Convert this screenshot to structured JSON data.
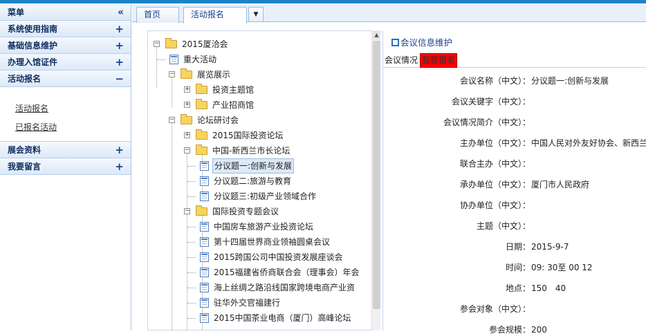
{
  "menu": {
    "header": {
      "label": "菜单",
      "icon": "double-chevron-left-icon"
    },
    "sections": [
      {
        "label": "系统使用指南",
        "sign": "+"
      },
      {
        "label": "基础信息维护",
        "sign": "+"
      },
      {
        "label": "办理入馆证件",
        "sign": "+"
      },
      {
        "label": "活动报名",
        "sign": "−"
      }
    ],
    "subitems": [
      "活动报名",
      "已报名活动"
    ],
    "bottom_sections": [
      {
        "label": "展会资料",
        "sign": "+"
      },
      {
        "label": "我要留言",
        "sign": "+"
      }
    ]
  },
  "tabs": [
    {
      "label": "首页"
    },
    {
      "label": "活动报名"
    }
  ],
  "tab_dropdown_icon": "▼",
  "tree": {
    "nodes": [
      {
        "label": "2015厦洽会",
        "type": "folder",
        "toggle": "−"
      },
      {
        "label": "重大活动",
        "type": "doc"
      },
      {
        "label": "展览展示",
        "type": "folder",
        "toggle": "−"
      },
      {
        "label": "投资主题馆",
        "type": "folder",
        "toggle": "+"
      },
      {
        "label": "产业招商馆",
        "type": "folder",
        "toggle": "+"
      },
      {
        "label": "论坛研讨会",
        "type": "folder",
        "toggle": "−"
      },
      {
        "label": "2015国际投资论坛",
        "type": "folder",
        "toggle": "+"
      },
      {
        "label": "中国-新西兰市长论坛",
        "type": "folder",
        "toggle": "−"
      },
      {
        "label": "分议题一:创新与发展",
        "type": "doc",
        "selected": true
      },
      {
        "label": "分议题二:旅游与教育",
        "type": "doc"
      },
      {
        "label": "分议题三:初级产业领域合作",
        "type": "doc"
      },
      {
        "label": "国际投资专题会议",
        "type": "folder",
        "toggle": "−"
      },
      {
        "label": "中国房车旅游产业投资论坛",
        "type": "doc"
      },
      {
        "label": "第十四届世界商业领袖圆桌会议",
        "type": "doc"
      },
      {
        "label": "2015跨国公司中国投资发展座谈会",
        "type": "doc"
      },
      {
        "label": "2015福建省侨商联合会（理事会）年会",
        "type": "doc"
      },
      {
        "label": "海上丝绸之路沿线国家跨境电商产业资",
        "type": "doc"
      },
      {
        "label": "驻华外交官福建行",
        "type": "doc"
      },
      {
        "label": "2015中国茶业电商（厦门）高峰论坛",
        "type": "doc"
      }
    ]
  },
  "panel": {
    "title": "会议信息维护",
    "subtabs": [
      "会议情况",
      "我要报名"
    ],
    "fields": [
      {
        "label": "会议名称（中文）：",
        "value": "分议题一:创新与发展"
      },
      {
        "label": "会议关键字（中文）：",
        "value": ""
      },
      {
        "label": "会议情况简介（中文）：",
        "value": ""
      },
      {
        "label": "主办单位（中文）：",
        "value": "中国人民对外友好协会、新西兰"
      },
      {
        "label": "联合主办（中文）：",
        "value": ""
      },
      {
        "label": "承办单位（中文）：",
        "value": "厦门市人民政府"
      },
      {
        "label": "协办单位（中文）：",
        "value": ""
      },
      {
        "label": "主题（中文）：",
        "value": ""
      },
      {
        "label": "日期：",
        "value": "2015-9-7"
      },
      {
        "label": "时间：",
        "value": "09: 30至 00 12"
      },
      {
        "label": "地点：",
        "value": "150　40"
      },
      {
        "label": "参会对象（中文）：",
        "value": ""
      },
      {
        "label": "参会规模：",
        "value": "200"
      }
    ]
  },
  "colors": {
    "accent": "#1b84c7",
    "header_text": "#15428b",
    "red_button": "#ff0000"
  }
}
